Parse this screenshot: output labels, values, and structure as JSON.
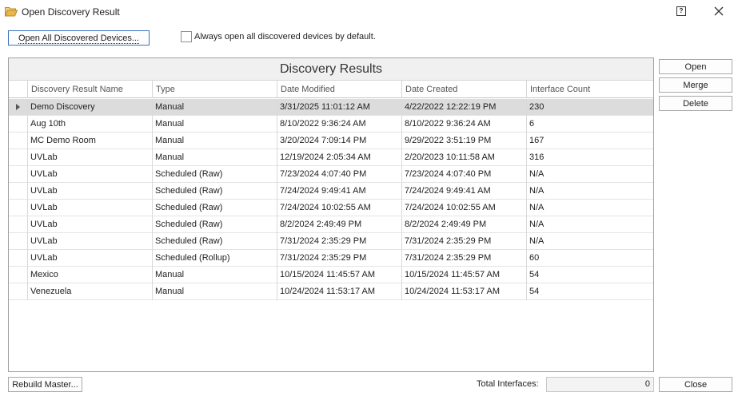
{
  "window": {
    "title": "Open Discovery Result",
    "help_label": "?"
  },
  "toolbar": {
    "open_all_label": "Open All Discovered Devices...",
    "always_open_label": "Always open all discovered devices by default.",
    "always_open_checked": false
  },
  "grid": {
    "caption": "Discovery Results",
    "columns": [
      "Discovery Result Name",
      "Type",
      "Date Modified",
      "Date Created",
      "Interface Count"
    ],
    "rows": [
      {
        "name": "Demo Discovery",
        "type": "Manual",
        "modified": "3/31/2025 11:01:12 AM",
        "created": "4/22/2022 12:22:19 PM",
        "count": "230"
      },
      {
        "name": "Aug 10th",
        "type": "Manual",
        "modified": "8/10/2022 9:36:24 AM",
        "created": "8/10/2022 9:36:24 AM",
        "count": "6"
      },
      {
        "name": "MC Demo Room",
        "type": "Manual",
        "modified": "3/20/2024 7:09:14 PM",
        "created": "9/29/2022 3:51:19 PM",
        "count": "167"
      },
      {
        "name": "UVLab",
        "type": "Manual",
        "modified": "12/19/2024 2:05:34 AM",
        "created": "2/20/2023 10:11:58 AM",
        "count": "316"
      },
      {
        "name": "UVLab",
        "type": "Scheduled (Raw)",
        "modified": "7/23/2024 4:07:40 PM",
        "created": "7/23/2024 4:07:40 PM",
        "count": "N/A"
      },
      {
        "name": "UVLab",
        "type": "Scheduled (Raw)",
        "modified": "7/24/2024 9:49:41 AM",
        "created": "7/24/2024 9:49:41 AM",
        "count": "N/A"
      },
      {
        "name": "UVLab",
        "type": "Scheduled (Raw)",
        "modified": "7/24/2024 10:02:55 AM",
        "created": "7/24/2024 10:02:55 AM",
        "count": "N/A"
      },
      {
        "name": "UVLab",
        "type": "Scheduled (Raw)",
        "modified": "8/2/2024 2:49:49 PM",
        "created": "8/2/2024 2:49:49 PM",
        "count": "N/A"
      },
      {
        "name": "UVLab",
        "type": "Scheduled (Raw)",
        "modified": "7/31/2024 2:35:29 PM",
        "created": "7/31/2024 2:35:29 PM",
        "count": "N/A"
      },
      {
        "name": "UVLab",
        "type": "Scheduled (Rollup)",
        "modified": "7/31/2024 2:35:29 PM",
        "created": "7/31/2024 2:35:29 PM",
        "count": "60"
      },
      {
        "name": "Mexico",
        "type": "Manual",
        "modified": "10/15/2024 11:45:57 AM",
        "created": "10/15/2024 11:45:57 AM",
        "count": "54"
      },
      {
        "name": "Venezuela",
        "type": "Manual",
        "modified": "10/24/2024 11:53:17 AM",
        "created": "10/24/2024 11:53:17 AM",
        "count": "54"
      }
    ],
    "selected_row": 0
  },
  "side_buttons": {
    "open_label": "Open",
    "merge_label": "Merge",
    "delete_label": "Delete"
  },
  "footer": {
    "rebuild_label": "Rebuild Master...",
    "total_label": "Total Interfaces:",
    "total_value": "0",
    "close_label": "Close"
  },
  "icons": {
    "title": "folder-open-icon",
    "help": "help-icon",
    "close": "close-icon",
    "row_indicator": "row-indicator-arrow-icon"
  },
  "colors": {
    "selected_row": "#dcdcdc",
    "caption_bg": "#f0f0f0",
    "folder": "#e8b84a",
    "focus_border": "#3a6fbf"
  }
}
